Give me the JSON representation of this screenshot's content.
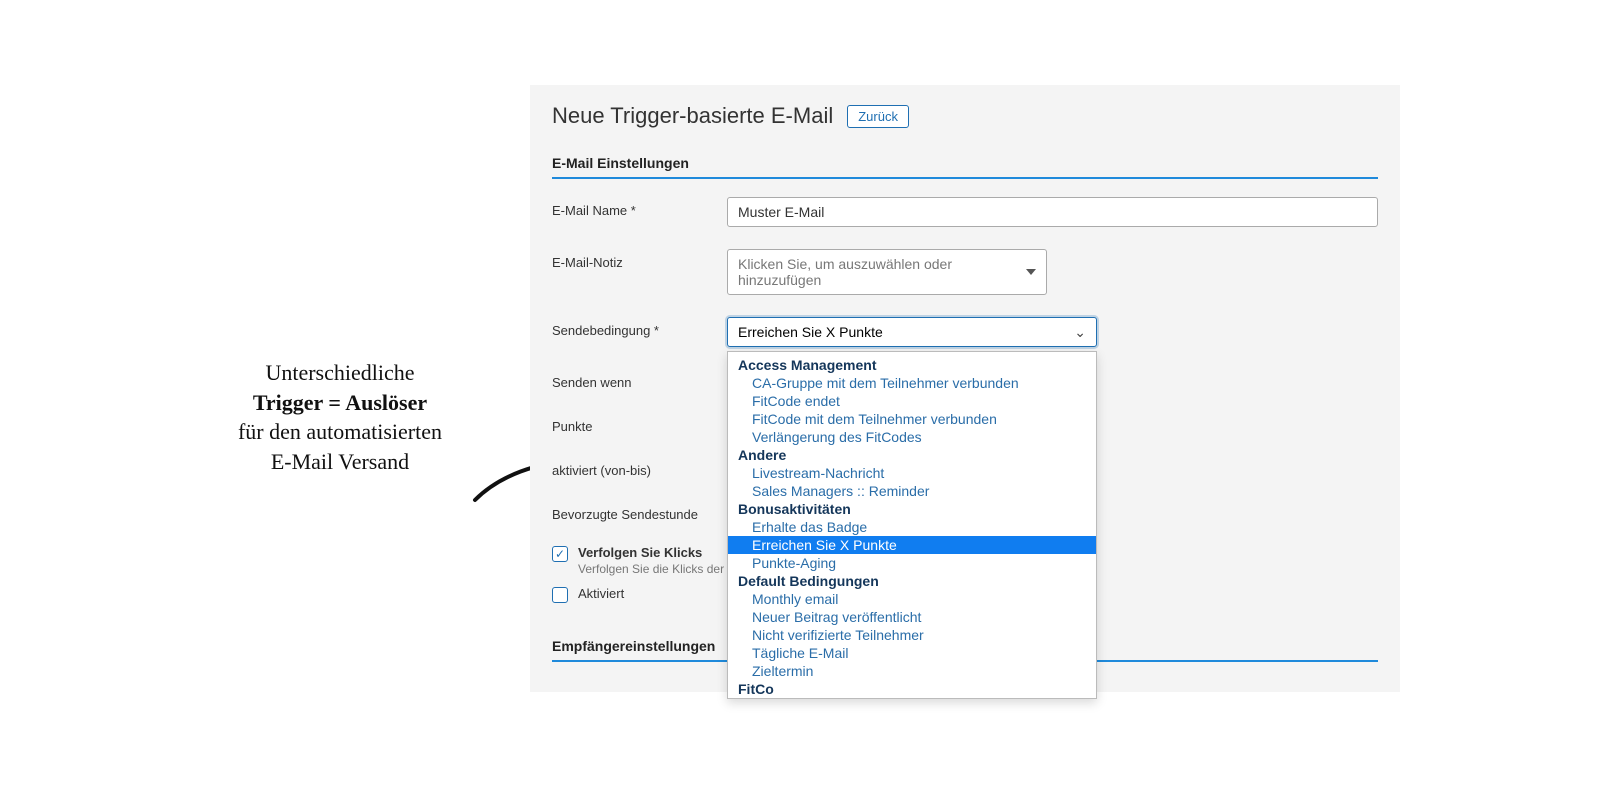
{
  "annotation": {
    "line1": "Unterschiedliche",
    "line2_bold": "Trigger = Auslöser",
    "line3": "für den automatisierten",
    "line4": "E-Mail Versand"
  },
  "header": {
    "title": "Neue Trigger-basierte E-Mail",
    "back": "Zurück"
  },
  "sections": {
    "settings": "E-Mail Einstellungen",
    "recipients": "Empfängereinstellungen"
  },
  "fields": {
    "name_label": "E-Mail Name *",
    "name_value": "Muster E-Mail",
    "note_label": "E-Mail-Notiz",
    "note_placeholder": "Klicken Sie, um auszuwählen oder hinzuzufügen",
    "condition_label": "Sendebedingung  *",
    "condition_value": "Erreichen Sie X Punkte",
    "send_when_label": "Senden wenn",
    "points_label": "Punkte",
    "active_range_label": "aktiviert (von-bis)",
    "pref_hour_label": "Bevorzugte Sendestunde",
    "track_clicks_label": "Verfolgen Sie Klicks",
    "track_clicks_help": "Verfolgen Sie die Klicks der Teil",
    "activated_label": "Aktiviert"
  },
  "dropdown_groups": [
    {
      "title": "Access Management",
      "items": [
        "CA-Gruppe mit dem Teilnehmer verbunden",
        "FitCode endet",
        "FitCode mit dem Teilnehmer verbunden",
        "Verlängerung des FitCodes"
      ]
    },
    {
      "title": "Andere",
      "items": [
        "Livestream-Nachricht",
        "Sales Managers :: Reminder"
      ]
    },
    {
      "title": "Bonusaktivitäten",
      "items": [
        "Erhalte das Badge",
        "Erreichen Sie X Punkte",
        "Punkte-Aging"
      ]
    },
    {
      "title": "Default Bedingungen",
      "items": [
        "Monthly email",
        "Neuer Beitrag veröffentlicht",
        "Nicht verifizierte Teilnehmer",
        "Tägliche E-Mail",
        "Zieltermin"
      ]
    },
    {
      "title": "FitCo",
      "items": []
    }
  ],
  "dropdown_selected": "Erreichen Sie X Punkte"
}
